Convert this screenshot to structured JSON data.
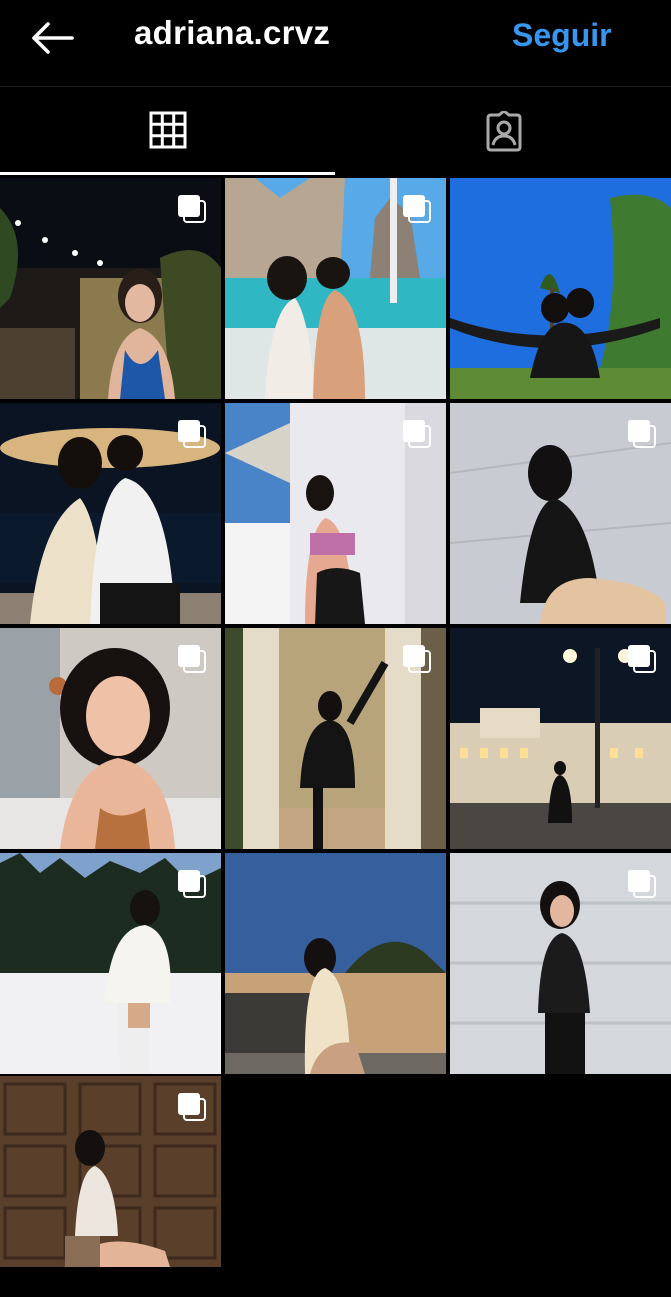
{
  "header": {
    "username": "adriana.crvz",
    "follow_label": "Seguir"
  },
  "icons": {
    "back": "arrow-left-icon",
    "grid_tab": "grid-icon",
    "tagged_tab": "tagged-person-icon",
    "multi": "multiple-images-icon"
  },
  "colors": {
    "background": "#000000",
    "accent": "#3797f0",
    "text": "#ffffff"
  },
  "posts": [
    {
      "scene": "night-garden-portrait",
      "multi": true
    },
    {
      "scene": "beach-couple",
      "multi": true
    },
    {
      "scene": "hammock-couple",
      "multi": false
    },
    {
      "scene": "fountain-couple-night",
      "multi": true
    },
    {
      "scene": "white-wall-pose",
      "multi": true
    },
    {
      "scene": "grey-wall-sunlight",
      "multi": true
    },
    {
      "scene": "indoor-selfie",
      "multi": true
    },
    {
      "scene": "doorway-pose",
      "multi": true
    },
    {
      "scene": "plaza-night",
      "multi": true
    },
    {
      "scene": "snow-forest",
      "multi": true
    },
    {
      "scene": "sunset-street",
      "multi": false
    },
    {
      "scene": "garage-door-pose",
      "multi": true
    },
    {
      "scene": "wood-wall-sitting",
      "multi": true
    }
  ]
}
